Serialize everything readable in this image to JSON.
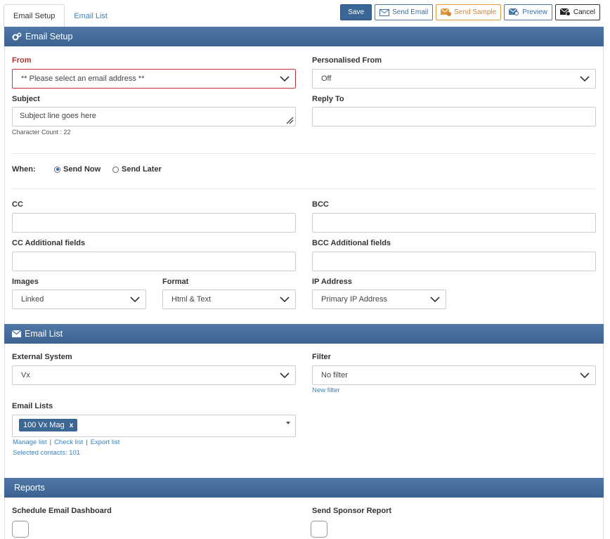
{
  "tabs": [
    {
      "label": "Email Setup",
      "active": true
    },
    {
      "label": "Email List",
      "active": false
    }
  ],
  "toolbar": {
    "save_label": "Save",
    "send_email_label": "Send Email",
    "send_sample_label": "Send Sample",
    "preview_label": "Preview",
    "cancel_label": "Cancel"
  },
  "email_setup": {
    "header": "Email Setup",
    "from": {
      "label": "From",
      "value": "** Please select an email address **"
    },
    "personalised_from": {
      "label": "Personalised From",
      "value": "Off"
    },
    "subject": {
      "label": "Subject",
      "value": "Subject line goes here",
      "char_count": "Character Count : 22"
    },
    "reply_to": {
      "label": "Reply To",
      "value": ""
    },
    "when": {
      "label": "When:",
      "send_now": "Send Now",
      "send_later": "Send Later",
      "selected": "Send Now"
    },
    "cc": {
      "label": "CC",
      "value": ""
    },
    "bcc": {
      "label": "BCC",
      "value": ""
    },
    "cc_additional": {
      "label": "CC Additional fields",
      "value": ""
    },
    "bcc_additional": {
      "label": "BCC Additional fields",
      "value": ""
    },
    "images": {
      "label": "Images",
      "value": "Linked"
    },
    "format": {
      "label": "Format",
      "value": "Html & Text"
    },
    "ip_address": {
      "label": "IP Address",
      "value": "Primary IP Address"
    }
  },
  "email_list": {
    "header": "Email List",
    "external_system": {
      "label": "External System",
      "value": "Vx"
    },
    "filter": {
      "label": "Filter",
      "value": "No filter",
      "new_filter_link": "New filter"
    },
    "email_lists": {
      "label": "Email Lists",
      "tags": [
        "100 Vx Mag"
      ],
      "tag_remove": "x"
    },
    "links": {
      "manage": "Manage list",
      "check": "Check list",
      "export": "Export list",
      "sep": "|"
    },
    "selected_contacts": "Selected contacts: 101"
  },
  "reports": {
    "header": "Reports",
    "schedule_dashboard": {
      "label": "Schedule Email Dashboard"
    },
    "sponsor_report": {
      "label": "Send Sponsor Report"
    }
  },
  "colors": {
    "header_bg": "#3b6291",
    "link": "#3a83c2",
    "error": "#b3312a",
    "sample_orange": "#d4832a"
  }
}
